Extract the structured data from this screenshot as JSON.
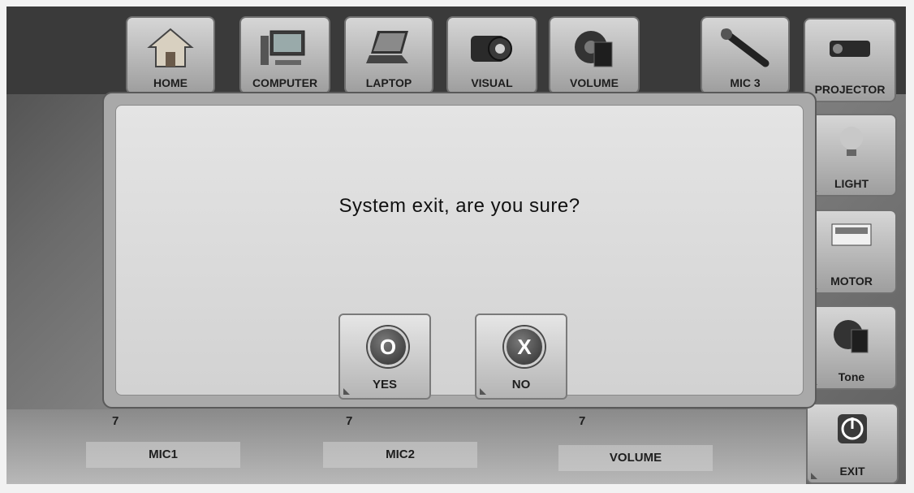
{
  "top_nav": [
    "HOME",
    "COMPUTER",
    "LAPTOP",
    "VISUAL",
    "VOLUME",
    "MIC 3",
    "PROJECTOR"
  ],
  "side_nav": [
    "LIGHT",
    "MOTOR",
    "Tone",
    "EXIT"
  ],
  "dialog": {
    "message": "System exit, are you sure?",
    "yes_glyph": "O",
    "yes_label": "YES",
    "no_glyph": "X",
    "no_label": "NO"
  },
  "bottom": {
    "mic1": {
      "level": "7",
      "label": "MIC1"
    },
    "mic2": {
      "level": "7",
      "label": "MIC2"
    },
    "volume": {
      "level": "7",
      "label": "VOLUME"
    }
  },
  "icons": [
    "home-icon",
    "computer-icon",
    "laptop-icon",
    "visual-icon",
    "volume-icon",
    "microphone-icon",
    "projector-icon",
    "light-bulb-icon",
    "motor-screen-icon",
    "tone-icon",
    "power-icon"
  ]
}
